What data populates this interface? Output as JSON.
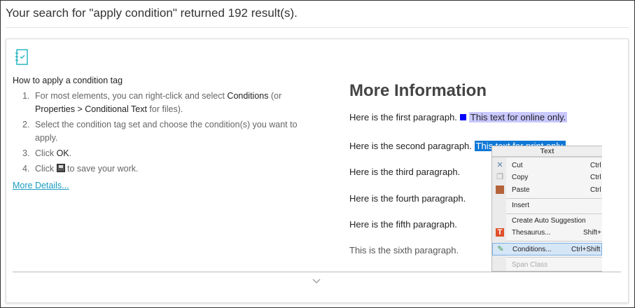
{
  "header": {
    "title": "Your search for \"apply condition\" returned 192 result(s)."
  },
  "result": {
    "icon": "checklist-icon",
    "heading": "How to apply a condition tag",
    "steps": [
      {
        "n": "1.",
        "pre": "For most elements, you can right-click and select ",
        "k1": "Conditions",
        "mid": " (or ",
        "k2": "Properties > Conditional Text",
        "post": " for files)."
      },
      {
        "n": "2.",
        "text": "Select the condition tag set and choose the condition(s) you want to apply."
      },
      {
        "n": "3.",
        "pre": "Click ",
        "k": "OK",
        "post": "."
      },
      {
        "n": "4.",
        "pre": "Click ",
        "post": " to save your work."
      }
    ],
    "more_link": "More Details..."
  },
  "screenshot": {
    "heading": "More Information",
    "p1": "Here is the first paragraph.",
    "p1_cond": "This text for online only.",
    "p2": "Here is the second paragraph.",
    "p2_cond": "This text for print only.",
    "p3": "Here is the third paragraph.",
    "p4": "Here is the fourth paragraph.",
    "p5": "Here is the fifth paragraph.",
    "p6": "This is the sixth paragraph.",
    "menu": {
      "header": "Text",
      "items": [
        {
          "label": "Cut",
          "shortcut": "Ctrl"
        },
        {
          "label": "Copy",
          "shortcut": "Ctrl"
        },
        {
          "label": "Paste",
          "shortcut": "Ctrl"
        },
        {
          "label": "Insert"
        },
        {
          "label": "Create Auto Suggestion"
        },
        {
          "label": "Thesaurus...",
          "shortcut": "Shift+"
        },
        {
          "label": "Conditions...",
          "shortcut": "Ctrl+Shift"
        },
        {
          "label": "Span Class"
        }
      ]
    }
  },
  "footer": {
    "expand_icon": "chevron-down-icon"
  }
}
